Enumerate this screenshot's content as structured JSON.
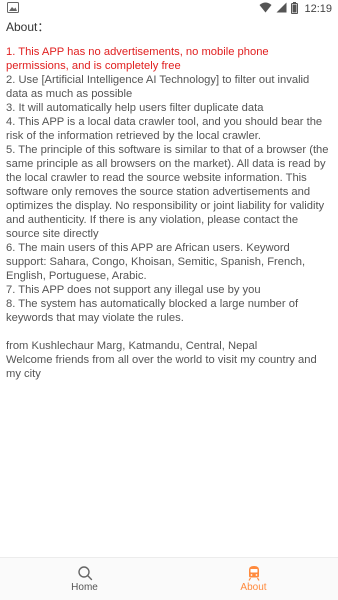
{
  "status_bar": {
    "time": "12:19",
    "icons": [
      "image-icon",
      "wifi-icon",
      "signal-icon",
      "battery-icon"
    ]
  },
  "about": {
    "heading": "About：",
    "items": [
      {
        "text": "1. This APP has no advertisements, no mobile phone permissions, and is completely free",
        "highlight": true
      },
      {
        "text": "2. Use [Artificial Intelligence AI Technology] to filter out invalid data as much as possible",
        "highlight": false
      },
      {
        "text": "3. It will automatically help users filter duplicate data",
        "highlight": false
      },
      {
        "text": "4. This APP is a local data crawler tool, and you should bear the risk of the information retrieved by the local crawler.",
        "highlight": false
      },
      {
        "text": "5. The principle of this software is similar to that of a browser (the same principle as all browsers on the market). All data is read by the local crawler to read the source website information. This software only removes the source station advertisements and optimizes the display. No responsibility or joint liability for validity and authenticity. If there is any violation, please contact the source site directly",
        "highlight": false
      },
      {
        "text": "6. The main users of this APP are African users. Keyword support: Sahara, Congo, Khoisan, Semitic, Spanish, French, English, Portuguese, Arabic.",
        "highlight": false
      },
      {
        "text": "7. This APP does not support any illegal use by you",
        "highlight": false
      },
      {
        "text": "8. The system has automatically blocked a large number of keywords that may violate the rules.",
        "highlight": false
      }
    ],
    "location": "from Kushlechaur Marg, Katmandu, Central, Nepal",
    "welcome": "Welcome friends from all over the world to visit my country and my city"
  },
  "bottom_nav": {
    "home_label": "Home",
    "about_label": "About",
    "active": "About",
    "active_color": "#ff8a3d",
    "inactive_color": "#555555"
  },
  "colors": {
    "highlight_text": "#e02020",
    "body_text": "#555555"
  }
}
